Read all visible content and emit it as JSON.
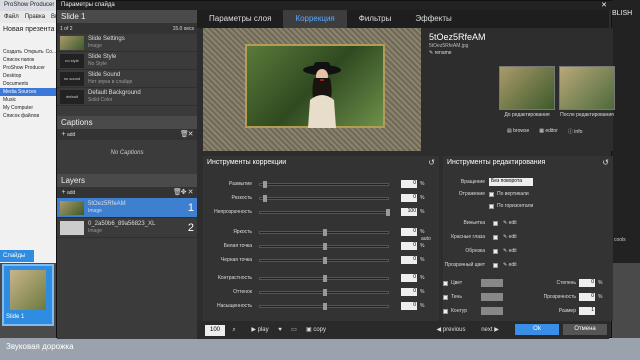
{
  "app": {
    "title": "ProShow Producer",
    "menu": [
      "Файл",
      "Правка",
      "Вид"
    ],
    "side": {
      "project": "Новая презента",
      "buttons": [
        "Создать",
        "Открыть",
        "Со..."
      ],
      "folders_hdr": "Список папок",
      "tree": [
        "ProShow Producer",
        "Desktop",
        "Documents",
        "Media Sources",
        "Music",
        "My Computer"
      ],
      "files_hdr": "Список файлов"
    },
    "slides_tab": "Слайды",
    "slide_label": "Slide 1",
    "track": "Звуковая дорожка",
    "right_label": "BLISH",
    "right_small": "cools"
  },
  "dialog": {
    "title": "Параметры слайда",
    "slide": {
      "name": "Slide 1",
      "page": "1 of 2",
      "duration": "15.0 secs"
    },
    "slide_items": [
      {
        "thumb": "",
        "title": "Slide Settings",
        "sub": "Image"
      },
      {
        "thumb": "no style",
        "title": "Slide Style",
        "sub": "No Style"
      },
      {
        "thumb": "no sound",
        "title": "Slide Sound",
        "sub": "Нет звука в слайде"
      },
      {
        "thumb": "default",
        "title": "Default Background",
        "sub": "Solid Color"
      }
    ],
    "captions": {
      "header": "Captions",
      "add": "add",
      "empty": "No Captions"
    },
    "layers": {
      "header": "Layers",
      "add": "add",
      "items": [
        {
          "name": "5tOez5RfeAM",
          "type": "Image",
          "num": "1"
        },
        {
          "name": "0_2a50b6_89a56823_XL",
          "type": "Image",
          "num": "2"
        }
      ]
    },
    "tabs": [
      "Параметры слоя",
      "Коррекция",
      "Фильтры",
      "Эффекты"
    ],
    "active_tab": 1,
    "layer_info": {
      "name": "5tOez5RfeAM",
      "file": "5tOez5RfeAM.jpg",
      "rename": "rename",
      "before": "До редактирования",
      "after": "После редактирования",
      "browse": "browse",
      "editor": "editor",
      "info": "info"
    },
    "correction": {
      "header": "Инструменты коррекции",
      "auto": "auto",
      "sliders": [
        {
          "label": "Размытие",
          "value": "0",
          "pos": 0.02
        },
        {
          "label": "Резкость",
          "value": "0",
          "pos": 0.02
        },
        {
          "label": "Непрозрачность",
          "value": "100",
          "pos": 1.0
        },
        {
          "label": "Яркость",
          "value": "0",
          "pos": 0.5
        },
        {
          "label": "Белая точка",
          "value": "0",
          "pos": 0.5
        },
        {
          "label": "Черная точка",
          "value": "0",
          "pos": 0.5
        },
        {
          "label": "Контрастность",
          "value": "0",
          "pos": 0.5
        },
        {
          "label": "Оттенок",
          "value": "0",
          "pos": 0.5
        },
        {
          "label": "Насыщенность",
          "value": "0",
          "pos": 0.5
        }
      ]
    },
    "editing": {
      "header": "Инструменты редактирования",
      "rotate_label": "Вращение",
      "rotate_value": "Без поворота",
      "flip_label": "Отражение",
      "vertical": "По вертикали",
      "horizontal": "По горизонтали",
      "edits": [
        {
          "label": "Виньетка",
          "action": "edit"
        },
        {
          "label": "Красные глаза",
          "action": "edit"
        },
        {
          "label": "Обрезка",
          "action": "edit"
        },
        {
          "label": "Прозрачный цвет",
          "action": "edit"
        }
      ],
      "color_label": "Цвет",
      "shadow_label": "Тень",
      "outline_label": "Контур",
      "strength_label": "Степень",
      "transparency_label": "Прозрачность",
      "size_label": "Размер",
      "strength": "0",
      "transparency": "0",
      "size": "1"
    },
    "bottom": {
      "zoom": "100",
      "play": "play",
      "copy": "copy",
      "previous": "previous",
      "next": "next",
      "ok": "Ok",
      "cancel": "Отмена"
    }
  }
}
